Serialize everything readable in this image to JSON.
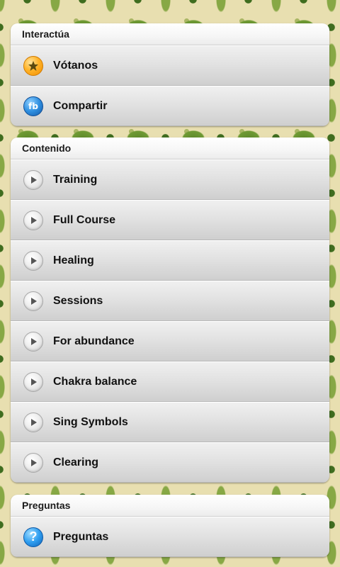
{
  "sections": [
    {
      "title": "Interactúa",
      "items": [
        {
          "label": "Vótanos",
          "icon": "star-icon"
        },
        {
          "label": "Compartir",
          "icon": "facebook-icon",
          "icon_text": "fb"
        }
      ]
    },
    {
      "title": "Contenido",
      "items": [
        {
          "label": "Training",
          "icon": "play-icon"
        },
        {
          "label": "Full Course",
          "icon": "play-icon"
        },
        {
          "label": "Healing",
          "icon": "play-icon"
        },
        {
          "label": "Sessions",
          "icon": "play-icon"
        },
        {
          "label": "For abundance",
          "icon": "play-icon"
        },
        {
          "label": "Chakra balance",
          "icon": "play-icon"
        },
        {
          "label": "Sing Symbols",
          "icon": "play-icon"
        },
        {
          "label": "Clearing",
          "icon": "play-icon"
        }
      ]
    },
    {
      "title": "Preguntas",
      "items": [
        {
          "label": "Preguntas",
          "icon": "help-icon",
          "icon_text": "?"
        }
      ]
    }
  ],
  "colors": {
    "background_cream": "#e8dfb0",
    "background_green": "#6f9a34",
    "row_light": "#f0f0f0",
    "row_dark": "#cfcfcf",
    "star_orange": "#ffb42a",
    "fb_blue": "#2f8fe0"
  }
}
